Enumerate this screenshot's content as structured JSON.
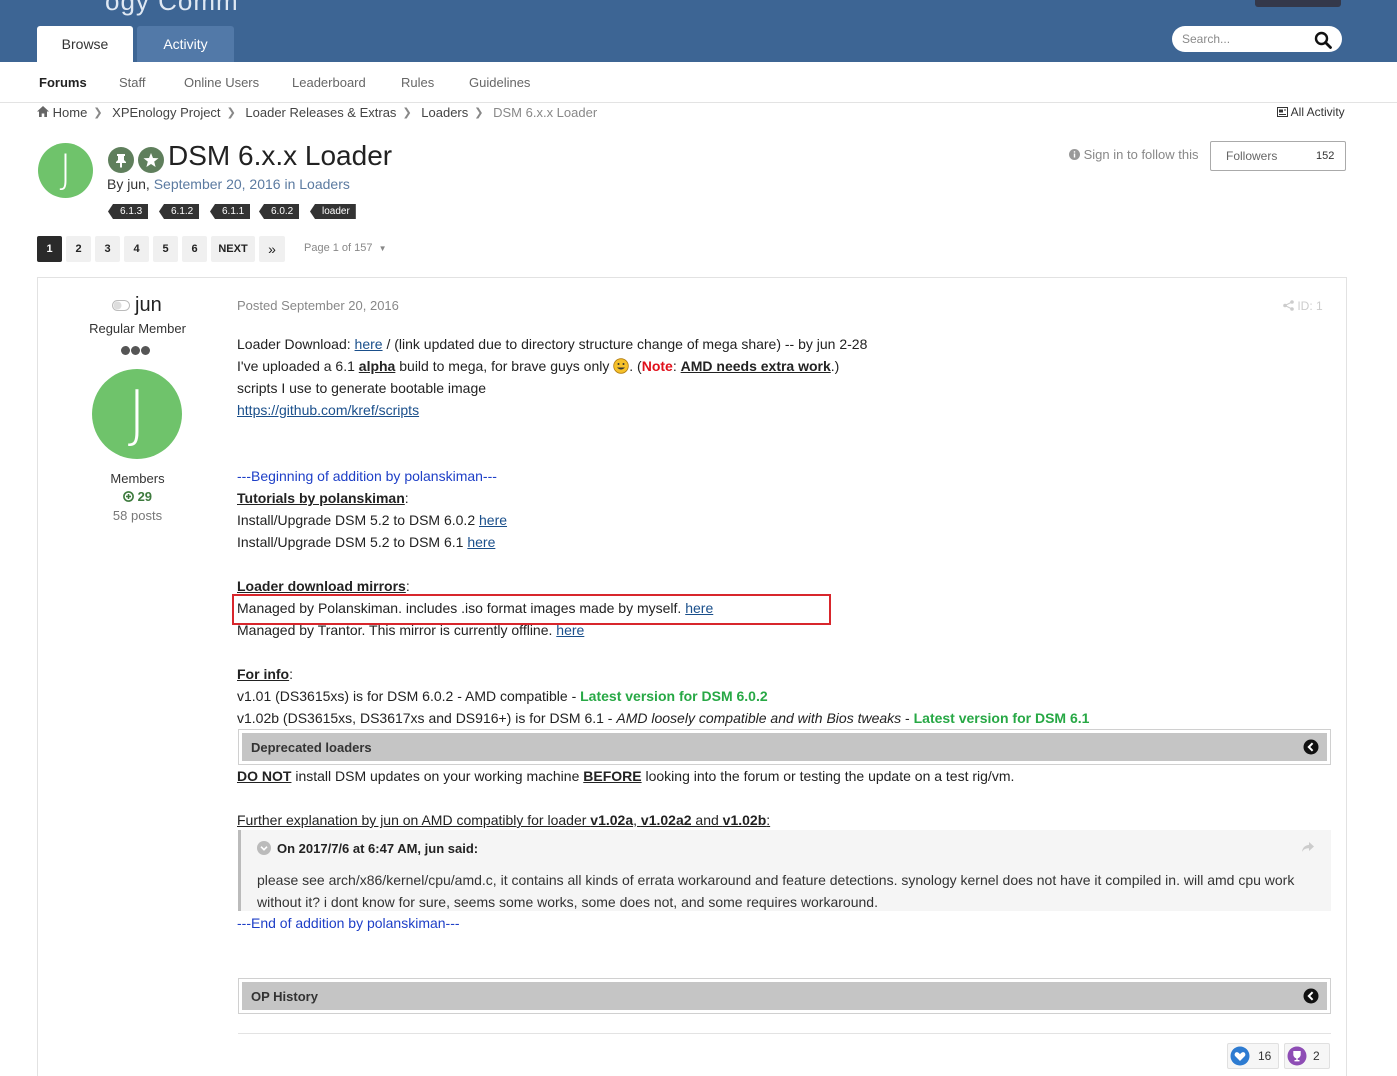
{
  "header": {
    "brand_fragment": "ogy Comm",
    "tabs": [
      {
        "label": "Browse"
      },
      {
        "label": "Activity"
      }
    ],
    "search": {
      "placeholder": "Search..."
    }
  },
  "subnav": [
    "Forums",
    "Staff",
    "Online Users",
    "Leaderboard",
    "Rules",
    "Guidelines"
  ],
  "breadcrumb": [
    "Home",
    "XPEnology Project",
    "Loader Releases & Extras",
    "Loaders",
    "DSM 6.x.x Loader"
  ],
  "all_activity": "All Activity",
  "topic": {
    "avatar_letter": "J",
    "title": "DSM 6.x.x Loader",
    "by": "By jun,",
    "date": "September 20, 2016",
    "in": "in",
    "forum": "Loaders",
    "tags": [
      "6.1.3",
      "6.1.2",
      "6.1.1",
      "6.0.2",
      "loader"
    ],
    "follow": "Sign in to follow this",
    "followers_label": "Followers",
    "followers_count": "152"
  },
  "pagination": {
    "pages": [
      "1",
      "2",
      "3",
      "4",
      "5",
      "6"
    ],
    "next": "NEXT",
    "last": "»",
    "page_of": "Page 1 of 157"
  },
  "author": {
    "name": "jun",
    "title": "Regular Member",
    "avatar_letter": "J",
    "group": "Members",
    "reputation": "29",
    "posts": "58 posts"
  },
  "post": {
    "posted": "Posted September 20, 2016",
    "id": "ID: 1",
    "l1_a": "Loader Download: ",
    "l1_link": "here",
    "l1_b": " / (link updated due to directory structure change of mega share) -- by jun 2-28",
    "l2_a": "I've uploaded a 6.1 ",
    "l2_b": "alpha",
    "l2_c": " build to mega, for brave guys only ",
    "l2_d": ". (",
    "l2_note": "Note",
    "l2_e": ": ",
    "l2_f": "AMD needs extra work",
    "l2_g": ".)",
    "l3": "scripts I use to generate bootable image",
    "l4_link": "https://github.com/kref/scripts",
    "begin": "---Beginning of addition by polanskiman---",
    "tut_head": "Tutorials by polanskiman",
    "tut_colon": ":",
    "tut1": "Install/Upgrade DSM 5.2 to DSM 6.0.2 ",
    "tut2": "Install/Upgrade DSM 5.2 to DSM 6.1 ",
    "here": "here",
    "mirrors_head": "Loader download mirrors",
    "mirrors_colon": ":",
    "mirror1": "Managed by Polanskiman. includes .iso format images made by myself. ",
    "mirror2": "Managed by Trantor. This mirror is currently offline. ",
    "info_head": "For info",
    "info_colon": ":",
    "info1_a": "v1.01 (DS3615xs) is for DSM 6.0.2 - AMD compatible - ",
    "info1_b": "Latest version for DSM 6.0.2",
    "info2_a": "v1.02b (DS3615xs, DS3617xs and DS916+) is for DSM 6.1 - ",
    "info2_b": "AMD loosely compatible and with Bios tweaks",
    "info2_c": " - ",
    "info2_d": "Latest version for DSM 6.1",
    "spoiler1": "Deprecated loaders",
    "warn_a": "DO NOT",
    "warn_b": " install DSM updates on your working machine ",
    "warn_c": "BEFORE",
    "warn_d": " looking into the forum or testing the update on a test rig/vm.",
    "further_a": "Further explanation by jun on AMD compatibly for loader ",
    "further_b": "v1.02a",
    "further_c": ", ",
    "further_d": "v1.02a2",
    "further_e": " and ",
    "further_f": "v1.02b",
    "further_g": ":",
    "quote_head": "On 2017/7/6 at 6:47 AM, jun said:",
    "quote_body": "please see arch/x86/kernel/cpu/amd.c, it contains all kinds of errata workaround and feature detections. synology kernel does not have it compiled in. will amd cpu work without it? i dont know for sure, seems some works, some does not, and some requires workaround.",
    "end": "---End of addition by polanskiman---",
    "spoiler2": "OP History"
  },
  "reactions": [
    {
      "icon": "like-icon",
      "count": "16"
    },
    {
      "icon": "trophy-icon",
      "count": "2"
    }
  ],
  "colors": {
    "header": "#3d6594",
    "avatar": "#6fc36b",
    "red": "#e0101b",
    "green": "#27a845",
    "blue": "#1e3fc7"
  }
}
